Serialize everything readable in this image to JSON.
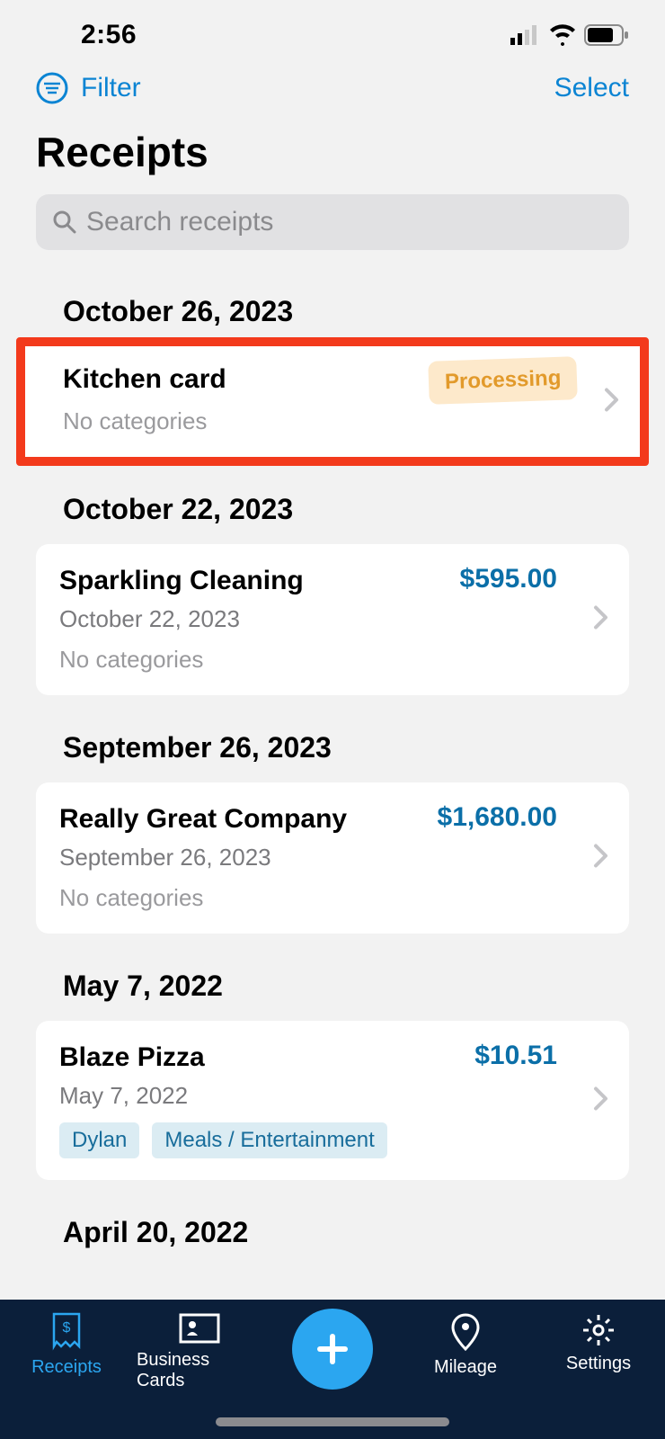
{
  "status": {
    "time": "2:56"
  },
  "topbar": {
    "filter": "Filter",
    "select": "Select"
  },
  "page": {
    "title": "Receipts"
  },
  "search": {
    "placeholder": "Search receipts"
  },
  "sections": [
    {
      "date": "October 26, 2023",
      "items": [
        {
          "title": "Kitchen card",
          "badge": "Processing",
          "nocats": "No categories",
          "highlighted": true
        }
      ]
    },
    {
      "date": "October 22, 2023",
      "items": [
        {
          "title": "Sparkling Cleaning",
          "amount": "$595.00",
          "subdate": "October 22, 2023",
          "nocats": "No categories"
        }
      ]
    },
    {
      "date": "September 26, 2023",
      "items": [
        {
          "title": "Really Great Company",
          "amount": "$1,680.00",
          "subdate": "September 26, 2023",
          "nocats": "No categories"
        }
      ]
    },
    {
      "date": "May 7, 2022",
      "items": [
        {
          "title": "Blaze Pizza",
          "amount": "$10.51",
          "subdate": "May 7, 2022",
          "tags": [
            "Dylan",
            "Meals / Entertainment"
          ]
        }
      ]
    },
    {
      "date": "April 20, 2022",
      "items": []
    }
  ],
  "nav": {
    "receipts": "Receipts",
    "business_cards": "Business Cards",
    "mileage": "Mileage",
    "settings": "Settings"
  }
}
